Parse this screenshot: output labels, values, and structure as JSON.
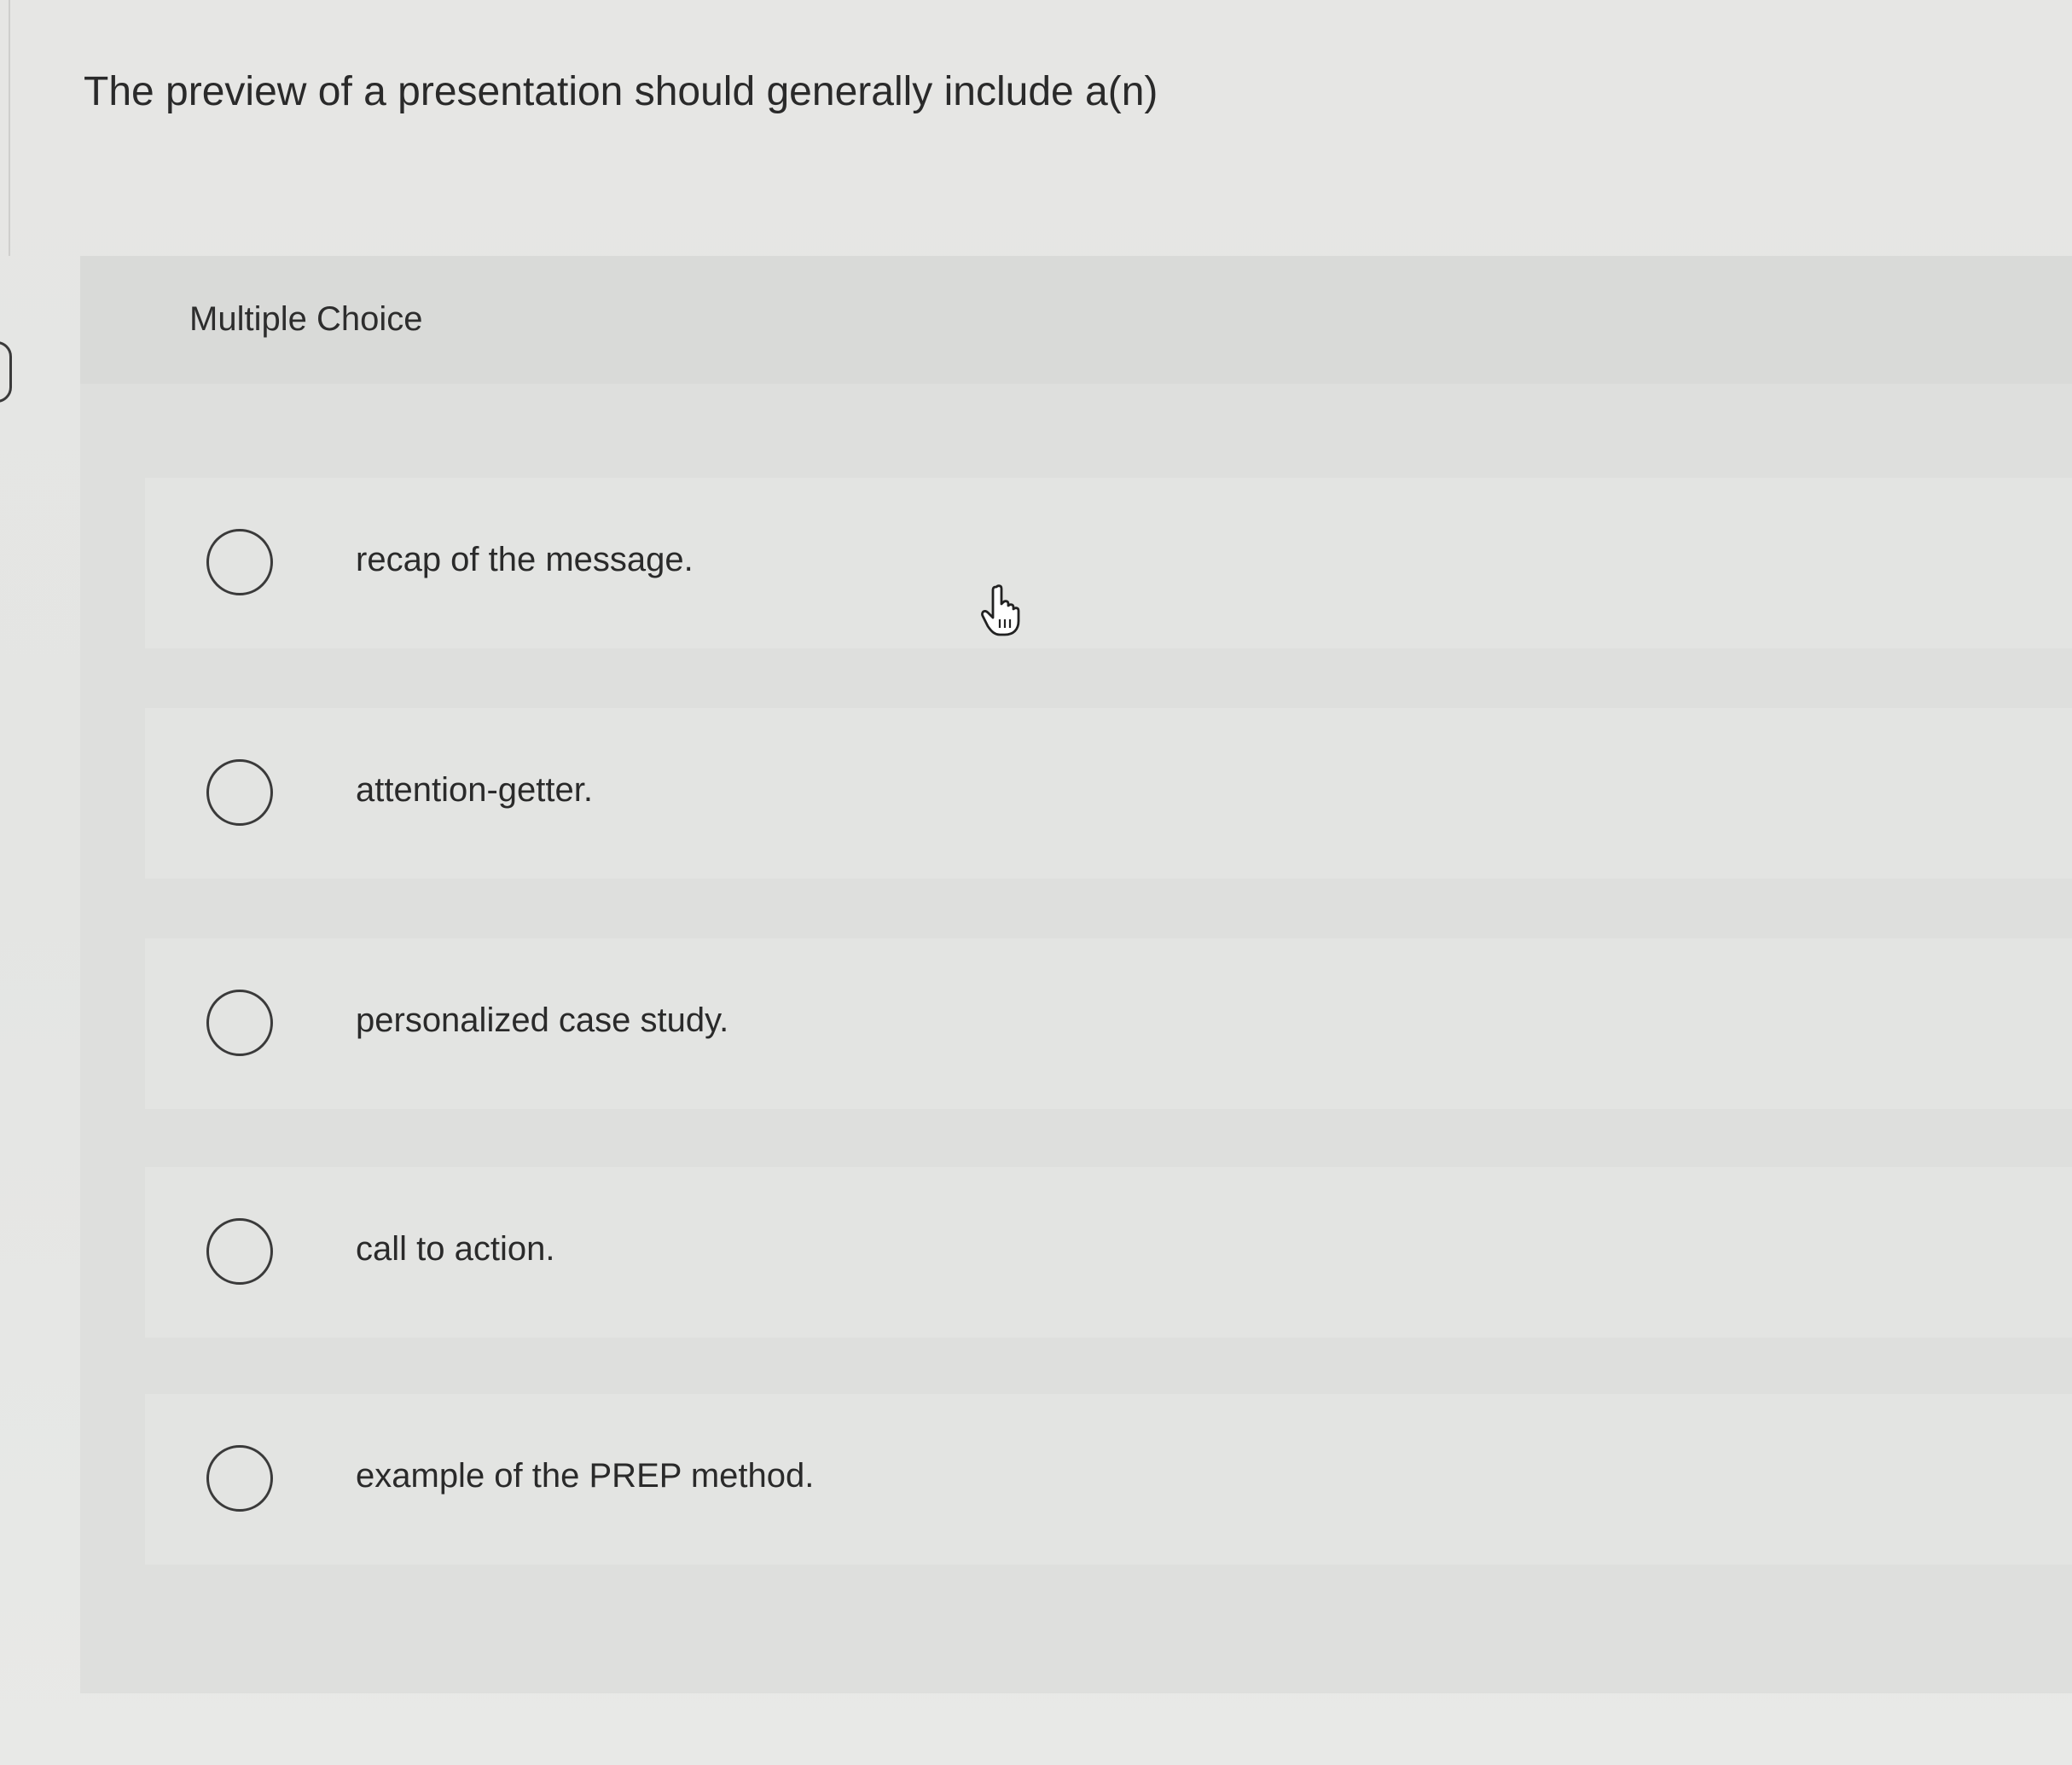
{
  "question": {
    "title": "The preview of a presentation should generally include a(n)"
  },
  "card": {
    "type_label": "Multiple Choice"
  },
  "choices": [
    {
      "label": "recap of the message.",
      "selected": false
    },
    {
      "label": "attention-getter.",
      "selected": false
    },
    {
      "label": "personalized case study.",
      "selected": false
    },
    {
      "label": "call to action.",
      "selected": false
    },
    {
      "label": "example of the PREP method.",
      "selected": false
    }
  ],
  "icons": {
    "radio": "radio-unselected-icon",
    "cursor": "hand-pointer-cursor-icon"
  },
  "colors": {
    "background": "#e6e6e4",
    "card": "#dedfdd",
    "text": "#2a2a2a"
  }
}
